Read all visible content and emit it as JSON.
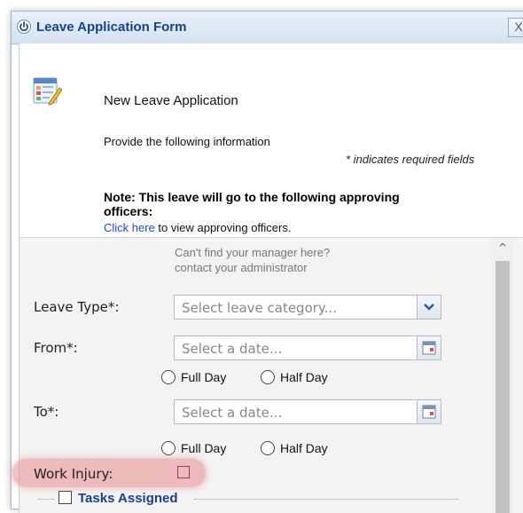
{
  "window": {
    "title": "Leave Application Form",
    "close_label": "X",
    "title_icon": "power-icon",
    "colors": {
      "title": "#15428b",
      "link": "#1a4fc4",
      "highlight": "#e67878"
    }
  },
  "header": {
    "app_icon": "form-edit-icon",
    "title": "New Leave Application",
    "provide_text": "Provide the following information",
    "required_note": "* indicates required fields",
    "note_line1": "Note: This leave will go to the following approving",
    "note_line2": "officers:",
    "click_link": "Click here",
    "click_suffix": " to view approving officers."
  },
  "form": {
    "help_line1": "Can't find your manager here?",
    "help_line2": "contact your administrator",
    "leave_type": {
      "label": "Leave Type*:",
      "placeholder": "Select leave category..."
    },
    "from": {
      "label": "From*:",
      "placeholder": "Select a date...",
      "options": [
        "Full Day",
        "Half Day"
      ]
    },
    "to": {
      "label": "To*:",
      "placeholder": "Select a date...",
      "options": [
        "Full Day",
        "Half Day"
      ]
    },
    "work_injury": {
      "label": "Work Injury:",
      "checked": false
    },
    "tasks": {
      "legend": "Tasks Assigned",
      "checked": false
    }
  }
}
